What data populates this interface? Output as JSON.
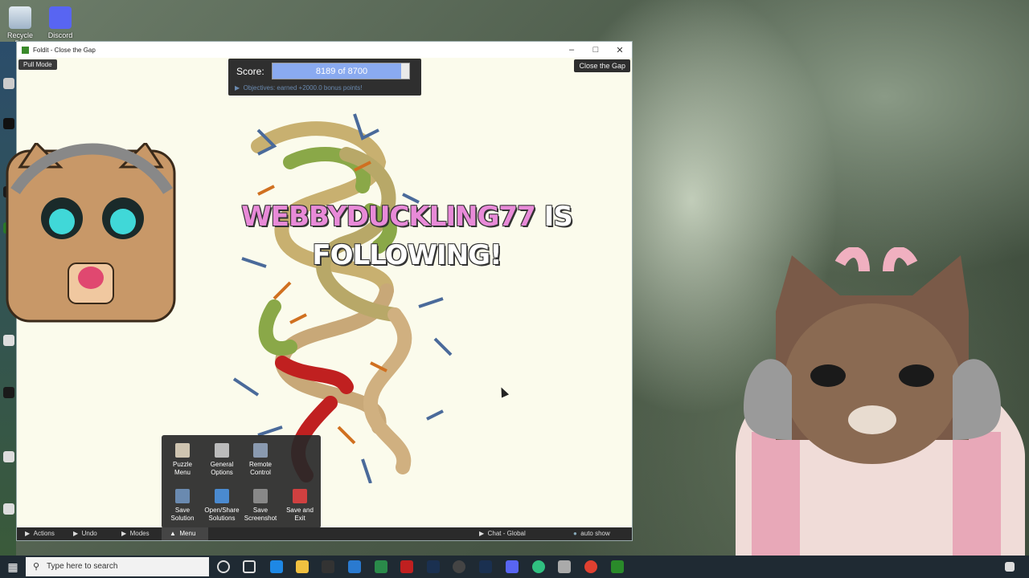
{
  "desktop": {
    "icons": [
      {
        "label": "Recycle Bin"
      },
      {
        "label": "Discord"
      }
    ]
  },
  "window": {
    "title": "Foldit - Close the Gap",
    "pull_mode": "Pull Mode",
    "close_gap": "Close the Gap",
    "score": {
      "label": "Score:",
      "value_text": "8189 of 8700",
      "current": 8189,
      "max": 8700
    },
    "objectives": "Objectives: earned +2000.0 bonus points!"
  },
  "overlay": {
    "follower_name": "WEBBYDUCKLING77",
    "follow_suffix": "IS",
    "follow_line2": "FOLLOWING!"
  },
  "menu": {
    "items": [
      {
        "label1": "Puzzle",
        "label2": "Menu"
      },
      {
        "label1": "General",
        "label2": "Options"
      },
      {
        "label1": "Remote",
        "label2": "Control"
      },
      {
        "label1": "Save",
        "label2": "Solution"
      },
      {
        "label1": "Open/Share",
        "label2": "Solutions"
      },
      {
        "label1": "Save",
        "label2": "Screenshot"
      },
      {
        "label1": "Save and",
        "label2": "Exit"
      }
    ]
  },
  "bottombar": {
    "actions": "Actions",
    "undo": "Undo",
    "modes": "Modes",
    "menu": "Menu",
    "chat": "Chat - Global",
    "auto_show": "auto show"
  },
  "taskbar": {
    "search_placeholder": "Type here to search"
  },
  "colors": {
    "score_fill": "#8aaaf0",
    "follow_name": "#e88ad8",
    "window_bg": "#fbfbec"
  }
}
